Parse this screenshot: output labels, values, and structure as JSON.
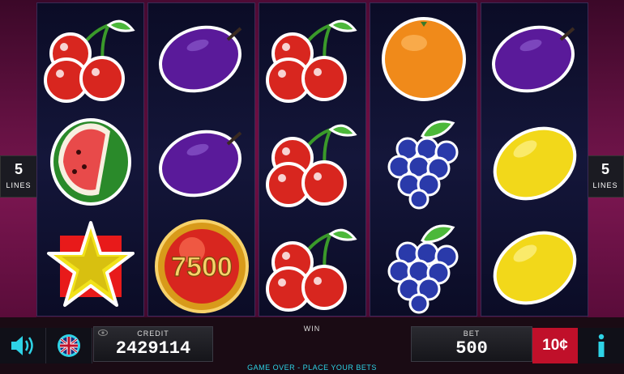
{
  "lines_left": {
    "value": "5",
    "label": "LINES"
  },
  "lines_right": {
    "value": "5",
    "label": "LINES"
  },
  "reels": [
    [
      "cherry",
      "watermelon",
      "star"
    ],
    [
      "plum",
      "plum",
      "coin-7500"
    ],
    [
      "cherry",
      "cherry",
      "cherry"
    ],
    [
      "orange",
      "grapes",
      "grapes"
    ],
    [
      "plum",
      "lemon",
      "lemon"
    ]
  ],
  "coin_value": "7500",
  "credit": {
    "label": "CREDIT",
    "value": "2429114"
  },
  "win": {
    "label": "WIN",
    "value": ""
  },
  "bet": {
    "label": "BET",
    "value": "500"
  },
  "denomination": "10¢",
  "status": "GAME OVER - PLACE YOUR BETS",
  "icons": {
    "sound": "speaker-icon",
    "language": "uk-flag-icon",
    "info": "info-icon"
  },
  "colors": {
    "accent": "#2ed3e6",
    "denom_bg": "#c0102a"
  }
}
